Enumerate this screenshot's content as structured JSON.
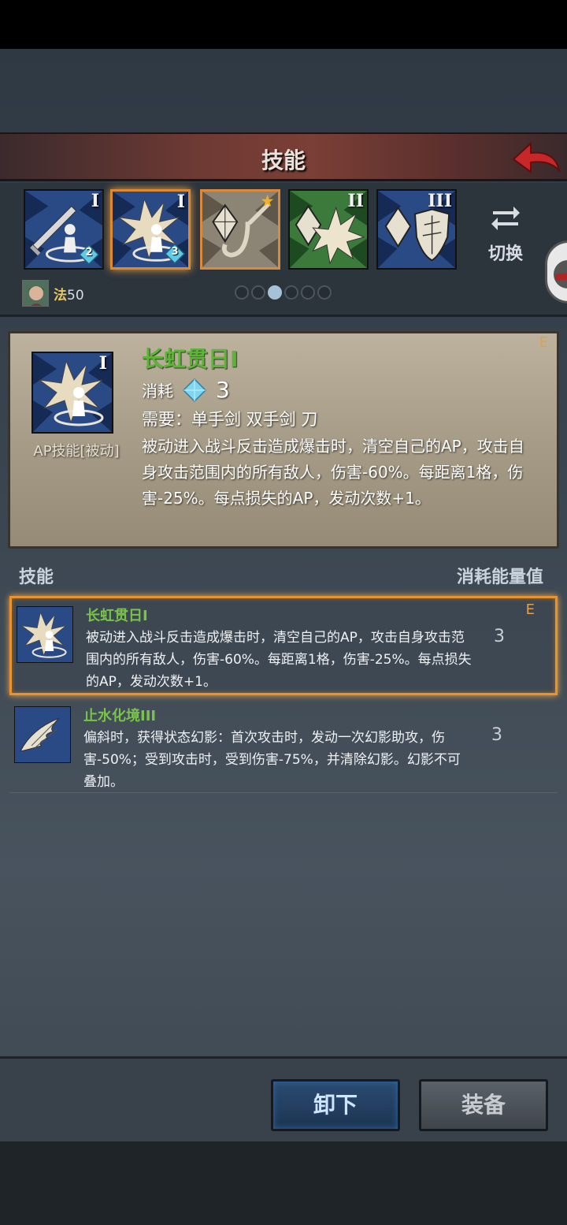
{
  "header": {
    "title": "技能",
    "back_icon": "back-arrow-icon"
  },
  "skill_slots": [
    {
      "rank": "I",
      "gem_count": "2",
      "icon": "sword-aura-icon"
    },
    {
      "rank": "I",
      "gem_count": "3",
      "icon": "burst-aura-icon",
      "selected": true
    },
    {
      "icon": "crystal-hook-icon",
      "star": true
    },
    {
      "rank": "II",
      "icon": "crystal-burst-icon"
    },
    {
      "rank": "III",
      "icon": "crystal-shield-icon"
    }
  ],
  "switch_label": "切换",
  "character": {
    "class_label": "法",
    "level": "50"
  },
  "page_dots": {
    "count": 6,
    "active_index": 2
  },
  "detail": {
    "name": "长虹贯日I",
    "rank": "I",
    "grade": "E",
    "type_label": "AP技能[被动]",
    "cost_label": "消耗",
    "cost_value": "3",
    "requirement": "需要：单手剑 双手剑 刀",
    "description": "被动进入战斗反击造成爆击时，清空自己的AP，攻击自身攻击范围内的所有敌人，伤害-60%。每距离1格，伤害-25%。每点损失的AP，发动次数+1。"
  },
  "list_header": {
    "left": "技能",
    "right": "消耗能量值"
  },
  "skill_list": [
    {
      "name": "长虹贯日I",
      "grade": "E",
      "description": "被动进入战斗反击造成爆击时，清空自己的AP，攻击自身攻击范围内的所有敌人，伤害-60%。每距离1格，伤害-25%。每点损失的AP，发动次数+1。",
      "value": "3"
    },
    {
      "name": "止水化境III",
      "description": "偏斜时，获得状态幻影：首次攻击时，发动一次幻影助攻，伤害-50%；受到攻击时，受到伤害-75%，并清除幻影。幻影不可叠加。",
      "value": "3"
    }
  ],
  "footer": {
    "unequip_label": "卸下",
    "equip_label": "装备"
  },
  "colors": {
    "accent_orange": "#e8932e",
    "skill_name_green": "#7ac34a",
    "icon_blue": "#2a4a86"
  }
}
